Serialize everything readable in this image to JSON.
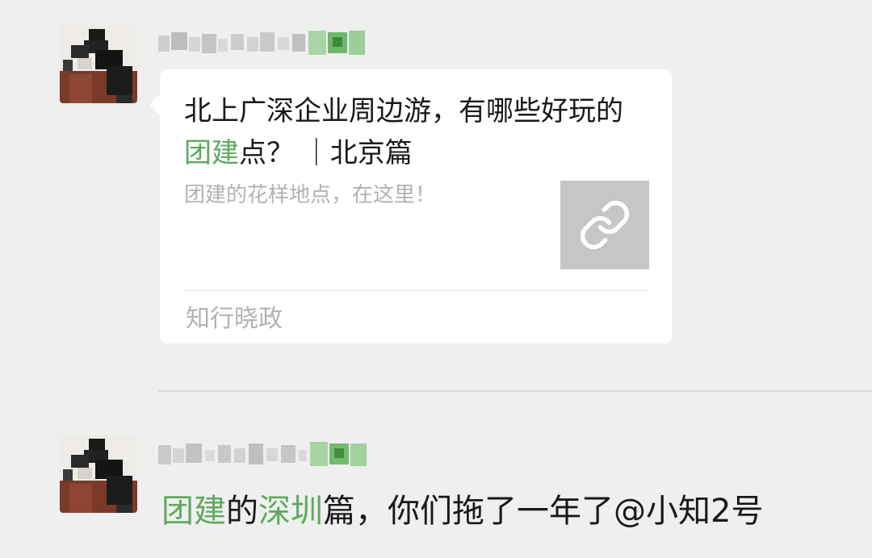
{
  "messages": [
    {
      "type": "link_card",
      "card": {
        "title_parts": [
          "北上广深企业周边游，有哪些好玩的",
          "团建",
          "点？ ｜北京篇"
        ],
        "description": "团建的花样地点，在这里！",
        "source": "知行晓政",
        "thumbnail_icon": "link-icon"
      }
    },
    {
      "type": "text",
      "text_parts": [
        "团建",
        "的",
        "深圳",
        "篇，你们拖了一年了@小知2号"
      ]
    }
  ],
  "colors": {
    "background": "#efefef",
    "bubble": "#ffffff",
    "text": "#191919",
    "secondary_text": "#b2b2b2",
    "highlight": "#5fa95f",
    "thumbnail_bg": "#c6c6c6"
  }
}
